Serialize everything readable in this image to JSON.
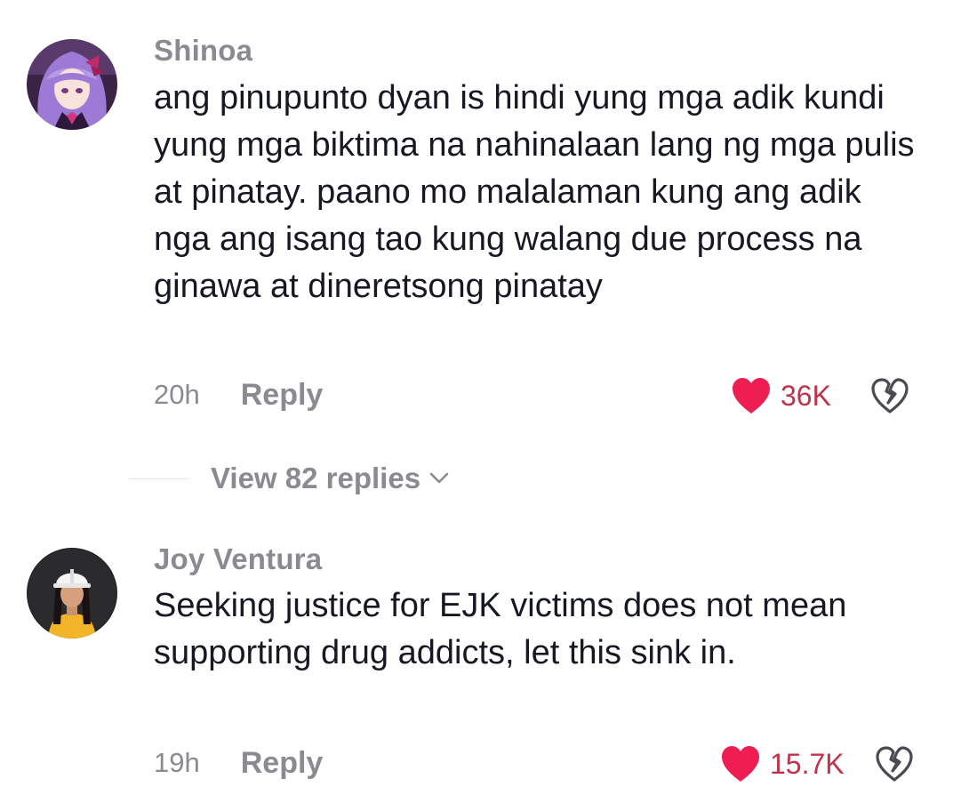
{
  "comments": [
    {
      "username": "Shinoa",
      "text": "ang pinupunto dyan is hindi yung mga adik kundi yung mga biktima na nahinalaan lang ng mga pulis at pinatay. paano mo malalaman kung ang adik nga ang isang tao kung walang due process na ginawa at dineretsong pinatay",
      "time": "20h",
      "reply_label": "Reply",
      "likes": "36K",
      "liked": true,
      "view_replies_label": "View 82 replies"
    },
    {
      "username": "Joy Ventura",
      "text": "Seeking justice for EJK victims does not mean supporting drug addicts, let this sink in.",
      "time": "19h",
      "reply_label": "Reply",
      "likes": "15.7K",
      "liked": true
    }
  ],
  "colors": {
    "like_red": "#ee1d52",
    "like_count": "#c0334a",
    "muted_text": "#8a8b91",
    "body_text": "#161823"
  },
  "icons": {
    "like": "heart-filled-icon",
    "dislike": "broken-heart-icon",
    "expand": "chevron-down-icon"
  }
}
